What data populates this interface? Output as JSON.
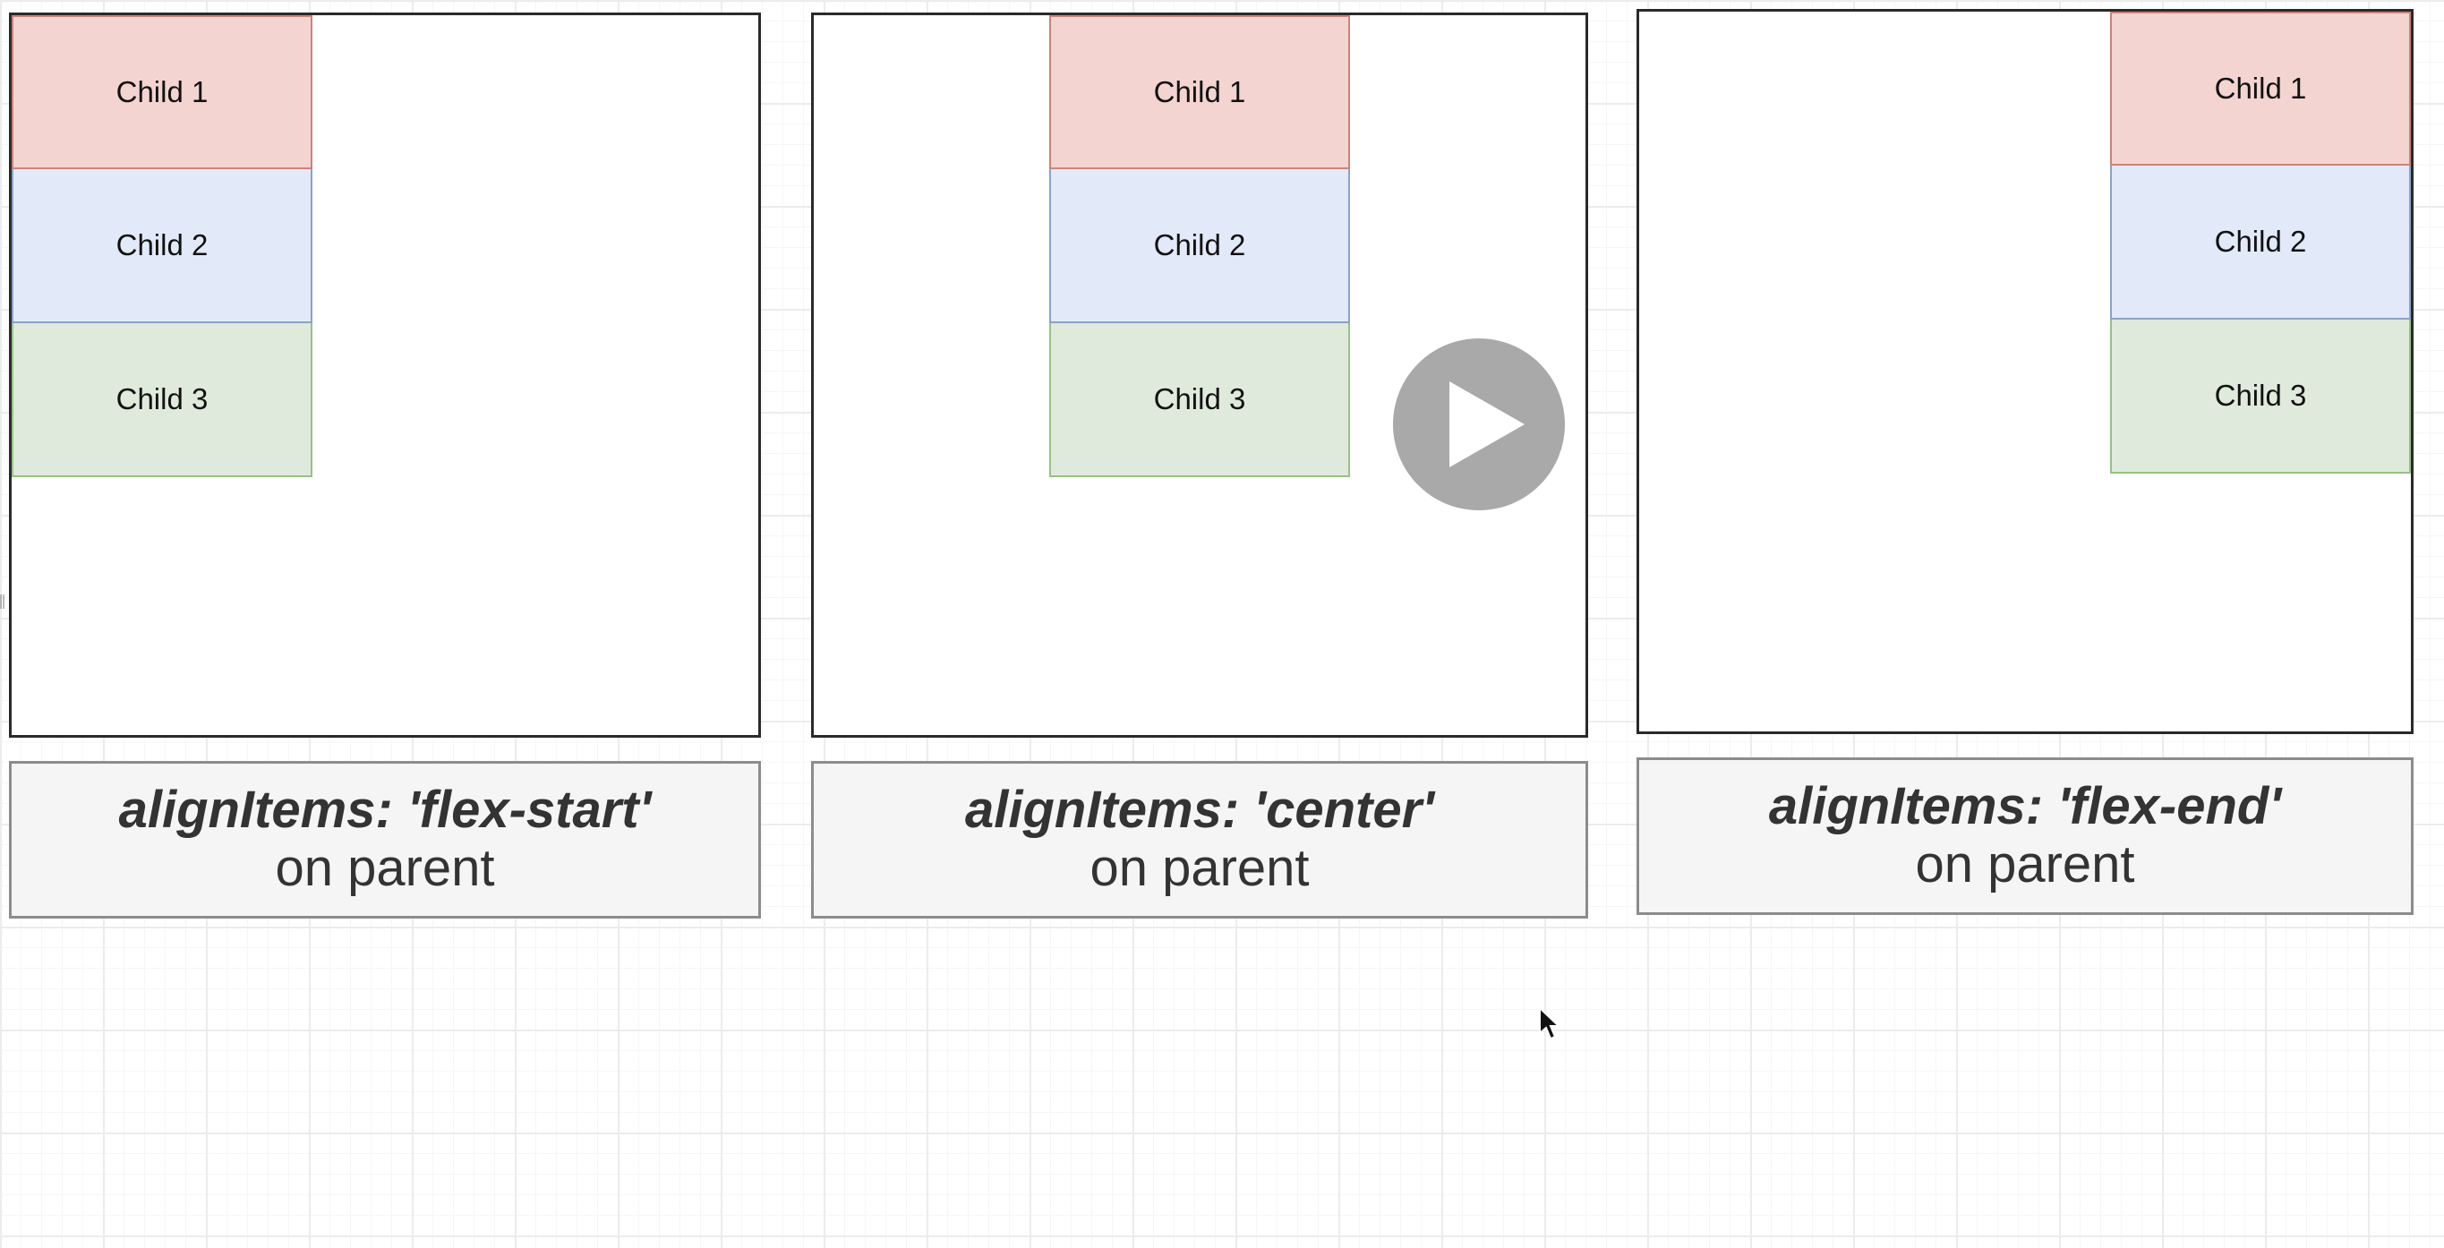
{
  "panels": [
    {
      "children": [
        "Child 1",
        "Child 2",
        "Child 3"
      ],
      "caption_prop": "alignItems: 'flex-start'",
      "caption_sub": "on parent"
    },
    {
      "children": [
        "Child 1",
        "Child 2",
        "Child 3"
      ],
      "caption_prop": "alignItems: 'center'",
      "caption_sub": "on parent"
    },
    {
      "children": [
        "Child 1",
        "Child 2",
        "Child 3"
      ],
      "caption_prop": "alignItems: 'flex-end'",
      "caption_sub": "on parent"
    }
  ],
  "icons": {
    "play": "play-icon",
    "cursor": "mouse-pointer-icon"
  },
  "colors": {
    "child_1_fill": "#f4d4d0",
    "child_1_stroke": "#c9837b",
    "child_2_fill": "#e2eafa",
    "child_2_stroke": "#8ba1c8",
    "child_3_fill": "#dfeadc",
    "child_3_stroke": "#97c08a",
    "caption_fill": "#f5f5f5",
    "caption_stroke": "#8c8c8c",
    "grid_line": "#ececec"
  }
}
